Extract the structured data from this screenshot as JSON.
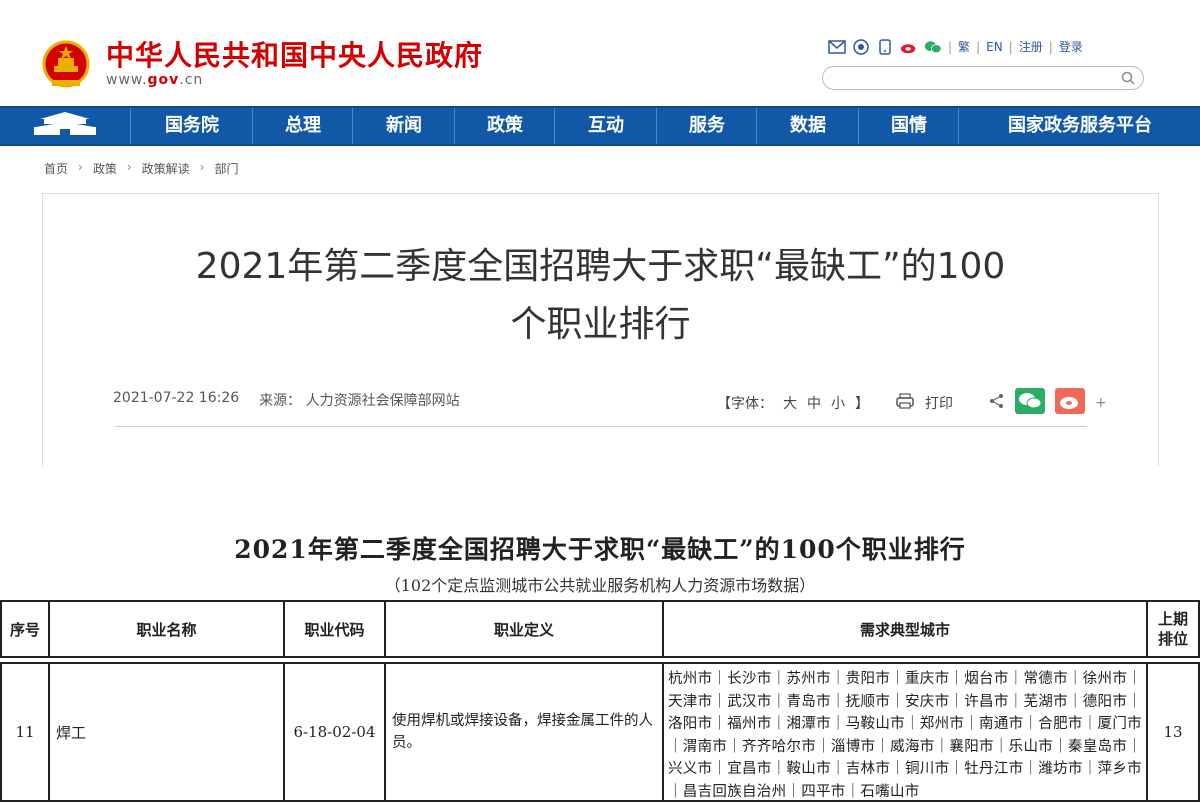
{
  "site": {
    "title": "中华人民共和国中央人民政府",
    "url_prefix": "www.",
    "url_brand": "gov",
    "url_suffix": ".cn"
  },
  "header_tools": {
    "links": [
      "繁",
      "EN",
      "注册",
      "登录"
    ]
  },
  "nav": {
    "items": [
      "国务院",
      "总理",
      "新闻",
      "政策",
      "互动",
      "服务",
      "数据",
      "国情",
      "国家政务服务平台"
    ]
  },
  "breadcrumb": [
    "首页",
    "政策",
    "政策解读",
    "部门"
  ],
  "article": {
    "title_line1": "2021年第二季度全国招聘大于求职“最缺工”的100",
    "title_line2": "个职业排行",
    "date": "2021-07-22  16:26",
    "source_label": "来源：",
    "source": "人力资源社会保障部网站",
    "font_label": "【字体：",
    "font_sizes": [
      "大",
      "中",
      "小"
    ],
    "font_close": "】",
    "print_label": "打印"
  },
  "table": {
    "title": "2021年第二季度全国招聘大于求职“最缺工”的100个职业排行",
    "subtitle": "（102个定点监测城市公共就业服务机构人力资源市场数据）",
    "headers": {
      "index": "序号",
      "name": "职业名称",
      "code": "职业代码",
      "definition": "职业定义",
      "cities": "需求典型城市",
      "prev_rank_line1": "上期",
      "prev_rank_line2": "排位"
    },
    "rows": [
      {
        "index": "11",
        "name": "焊工",
        "code": "6-18-02-04",
        "definition": "使用焊机或焊接设备，焊接金属工件的人员。",
        "cities": "杭州市｜长沙市｜苏州市｜贵阳市｜重庆市｜烟台市｜常德市｜徐州市｜天津市｜武汉市｜青岛市｜抚顺市｜安庆市｜许昌市｜芜湖市｜德阳市｜洛阳市｜福州市｜湘潭市｜马鞍山市｜郑州市｜南通市｜合肥市｜厦门市｜渭南市｜齐齐哈尔市｜淄博市｜威海市｜襄阳市｜乐山市｜秦皇岛市｜兴义市｜宜昌市｜鞍山市｜吉林市｜铜川市｜牡丹江市｜潍坊市｜萍乡市｜昌吉回族自治州｜四平市｜石嘴山市",
        "prev_rank": "13"
      }
    ]
  },
  "colors": {
    "brand_red": "#d40000",
    "nav_blue": "#1158a7",
    "link_blue": "#2c5aa0"
  }
}
